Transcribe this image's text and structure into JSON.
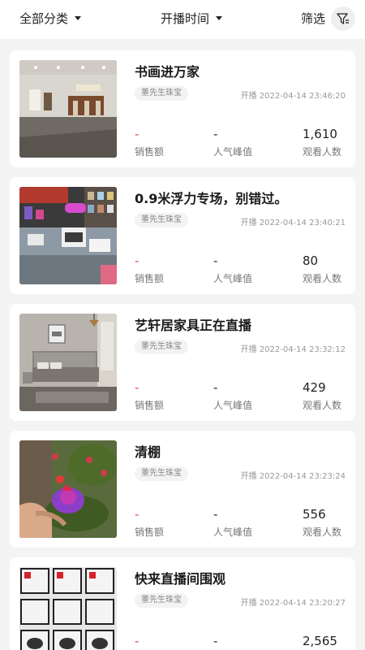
{
  "header": {
    "category_label": "全部分类",
    "time_label": "开播时间",
    "filter_label": "筛选"
  },
  "stat_labels": {
    "sales": "销售额",
    "peak": "人气峰值",
    "viewers": "观看人数"
  },
  "streams": [
    {
      "title": "书画进万家",
      "shop": "董先生珠宝",
      "start": "开播 2022-04-14 23:46:20",
      "sales": "-",
      "peak": "-",
      "viewers": "1,610",
      "thumb_icon": "gallery-hall-photo"
    },
    {
      "title": "0.9米浮力专场，别错过。",
      "shop": "董先生珠宝",
      "start": "开播 2022-04-14 23:40:21",
      "sales": "-",
      "peak": "-",
      "viewers": "80",
      "thumb_icon": "fishing-gear-shop-photo"
    },
    {
      "title": "艺轩居家具正在直播",
      "shop": "董先生珠宝",
      "start": "开播 2022-04-14 23:32:12",
      "sales": "-",
      "peak": "-",
      "viewers": "429",
      "thumb_icon": "bedroom-photo"
    },
    {
      "title": "清棚",
      "shop": "董先生珠宝",
      "start": "开播 2022-04-14 23:23:24",
      "sales": "-",
      "peak": "-",
      "viewers": "556",
      "thumb_icon": "flower-photo"
    },
    {
      "title": "快来直播间围观",
      "shop": "董先生珠宝",
      "start": "开播 2022-04-14 23:20:27",
      "sales": "-",
      "peak": "-",
      "viewers": "2,565",
      "thumb_icon": "fishing-reel-photo"
    }
  ]
}
